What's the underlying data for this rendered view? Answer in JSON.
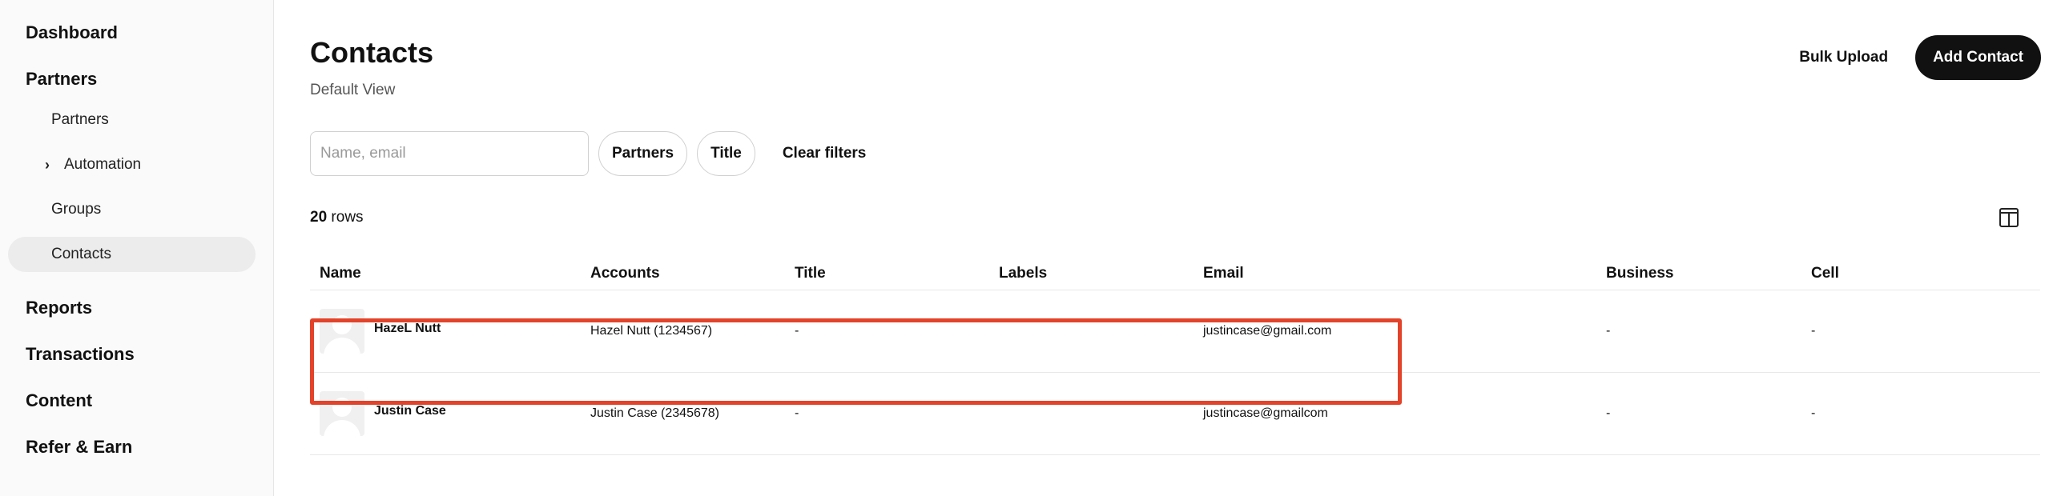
{
  "sidebar": {
    "dashboard": "Dashboard",
    "partners_section": "Partners",
    "items": [
      {
        "label": "Partners"
      },
      {
        "label": "Automation",
        "has_chevron": true
      },
      {
        "label": "Groups"
      },
      {
        "label": "Contacts",
        "active": true
      }
    ],
    "reports": "Reports",
    "transactions": "Transactions",
    "content": "Content",
    "refer": "Refer & Earn"
  },
  "header": {
    "title": "Contacts",
    "subtitle": "Default View",
    "bulk_upload": "Bulk Upload",
    "add_contact": "Add Contact"
  },
  "filters": {
    "search_placeholder": "Name, email",
    "search_value": "",
    "chips": [
      "Partners",
      "Title"
    ],
    "clear": "Clear filters"
  },
  "rows_info": {
    "count": "20",
    "label": "rows"
  },
  "table": {
    "columns": [
      "Name",
      "Accounts",
      "Title",
      "Labels",
      "Email",
      "Business",
      "Cell"
    ],
    "rows": [
      {
        "name": "HazeL Nutt",
        "accounts": "Hazel Nutt (1234567)",
        "title": "-",
        "labels": "",
        "email": "justincase@gmail.com",
        "business": "-",
        "cell": "-"
      },
      {
        "name": "Justin Case",
        "accounts": "Justin Case (2345678)",
        "title": "-",
        "labels": "",
        "email": "justincase@gmailcom",
        "business": "-",
        "cell": "-"
      }
    ]
  },
  "icons": {
    "columns_toggle": "columns-icon",
    "chevron": "chevron-right-icon",
    "avatar": "avatar-placeholder-icon"
  },
  "colors": {
    "accent": "#111111",
    "highlight": "#e2432a",
    "active_nav": "#ececec"
  }
}
